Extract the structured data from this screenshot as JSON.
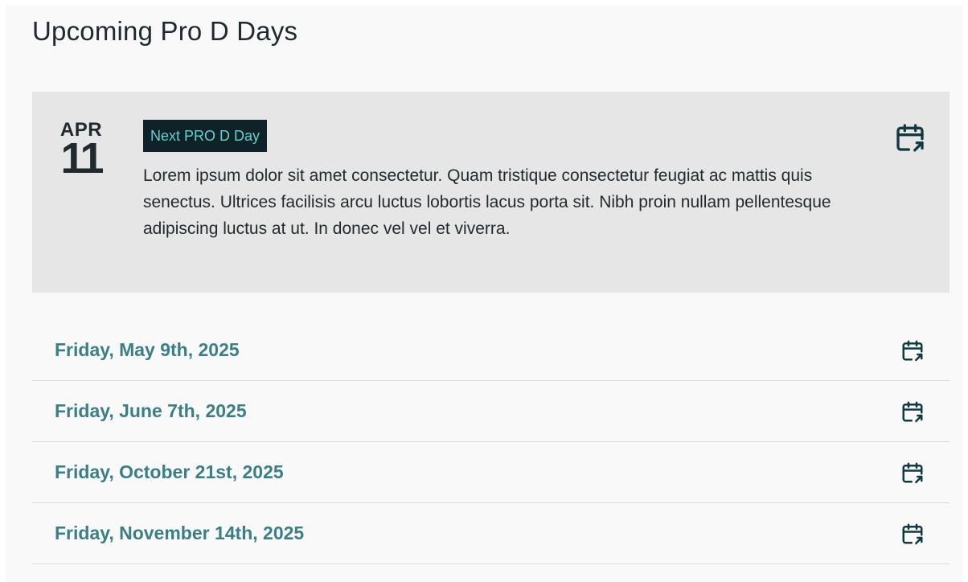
{
  "section": {
    "title": "Upcoming Pro D Days"
  },
  "featured": {
    "month": "APR",
    "day": "11",
    "badge": "Next PRO D Day",
    "description": "Lorem ipsum dolor sit amet consectetur. Quam tristique consectetur feugiat ac mattis quis senectus. Ultrices facilisis arcu luctus lobortis lacus porta sit. Nibh proin nullam pellentesque adipiscing luctus at ut. In donec vel vel et viverra.",
    "icon": "calendar-export-icon"
  },
  "events": [
    {
      "date": "Friday, May 9th, 2025",
      "icon": "calendar-export-icon"
    },
    {
      "date": "Friday, June 7th, 2025",
      "icon": "calendar-export-icon"
    },
    {
      "date": "Friday, October 21st, 2025",
      "icon": "calendar-export-icon"
    },
    {
      "date": "Friday, November 14th, 2025",
      "icon": "calendar-export-icon"
    }
  ],
  "colors": {
    "panel_background": "#f9f9f9",
    "featured_background": "#e6e6e6",
    "badge_background": "#0f2227",
    "badge_text": "#5fd2d2",
    "event_date_text": "#3a7f85",
    "icon_stroke": "#0f3a40",
    "divider": "#d9d9d9"
  }
}
